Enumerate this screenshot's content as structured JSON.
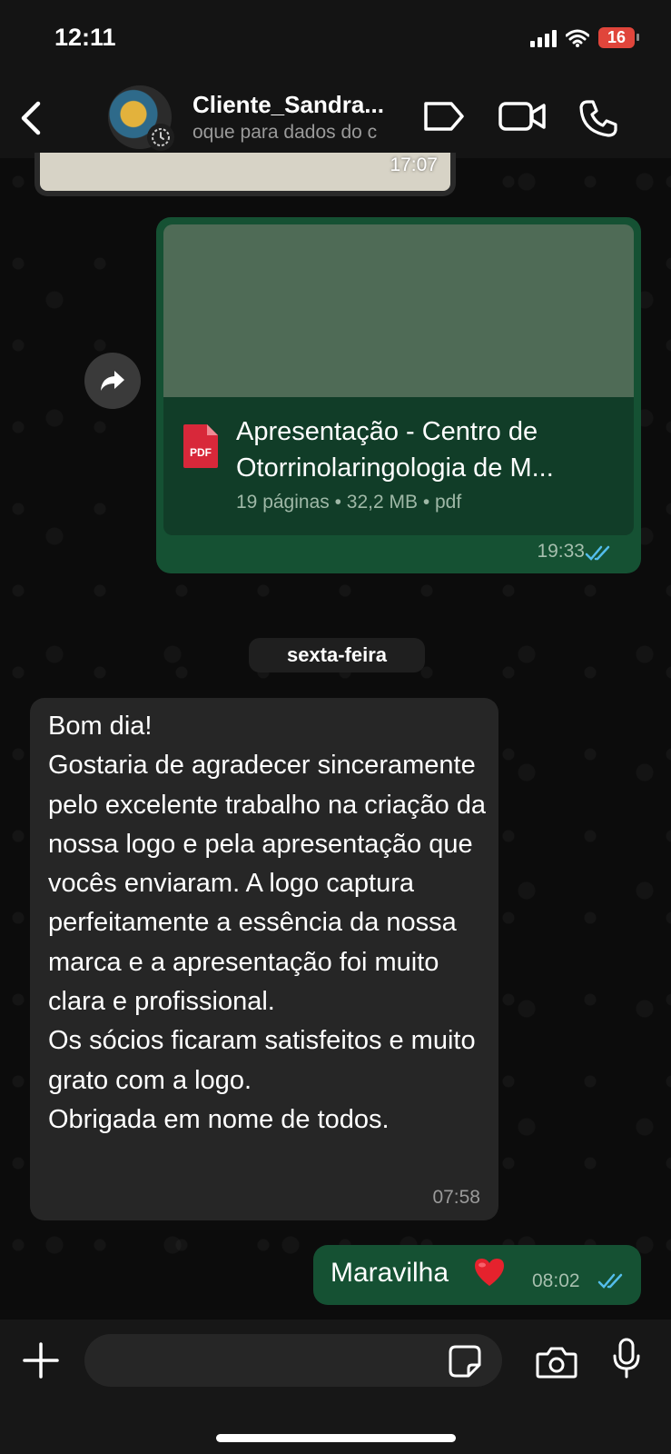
{
  "status_bar": {
    "time": "12:11",
    "battery": "16"
  },
  "header": {
    "contact_name": "Cliente_Sandra...",
    "subtitle": "oque para dados do c"
  },
  "messages": {
    "previous_time": "17:07",
    "document": {
      "title": "Apresentação - Centro de Otorrinolaringologia de M...",
      "meta": "19 páginas • 32,2 MB • pdf",
      "time": "19:33",
      "icon_label": "PDF"
    },
    "date_separator": "sexta-feira",
    "incoming_text": "Bom dia!\nGostaria de agradecer sinceramente pelo excelente trabalho na criação da nossa logo e pela apresentação que vocês enviaram. A logo captura perfeitamente a essência da nossa marca e a apresentação foi muito clara e profissional.\nOs sócios ficaram satisfeitos  e muito grato com a logo.\nObrigada em nome de todos.",
    "incoming_time": "07:58",
    "outgoing_text": "Maravilha",
    "outgoing_time": "08:02"
  },
  "composer": {
    "placeholder": ""
  },
  "icons": [
    "back-chevron",
    "tag-label",
    "video-call",
    "phone-call",
    "forward-arrow",
    "pdf-file",
    "read-ticks",
    "heart-emoji",
    "plus",
    "sticker",
    "camera",
    "microphone"
  ],
  "colors": {
    "outgoing_bubble": "#155133",
    "incoming_bubble": "#262626",
    "read_tick": "#53bdeb",
    "battery": "#e0453b"
  }
}
